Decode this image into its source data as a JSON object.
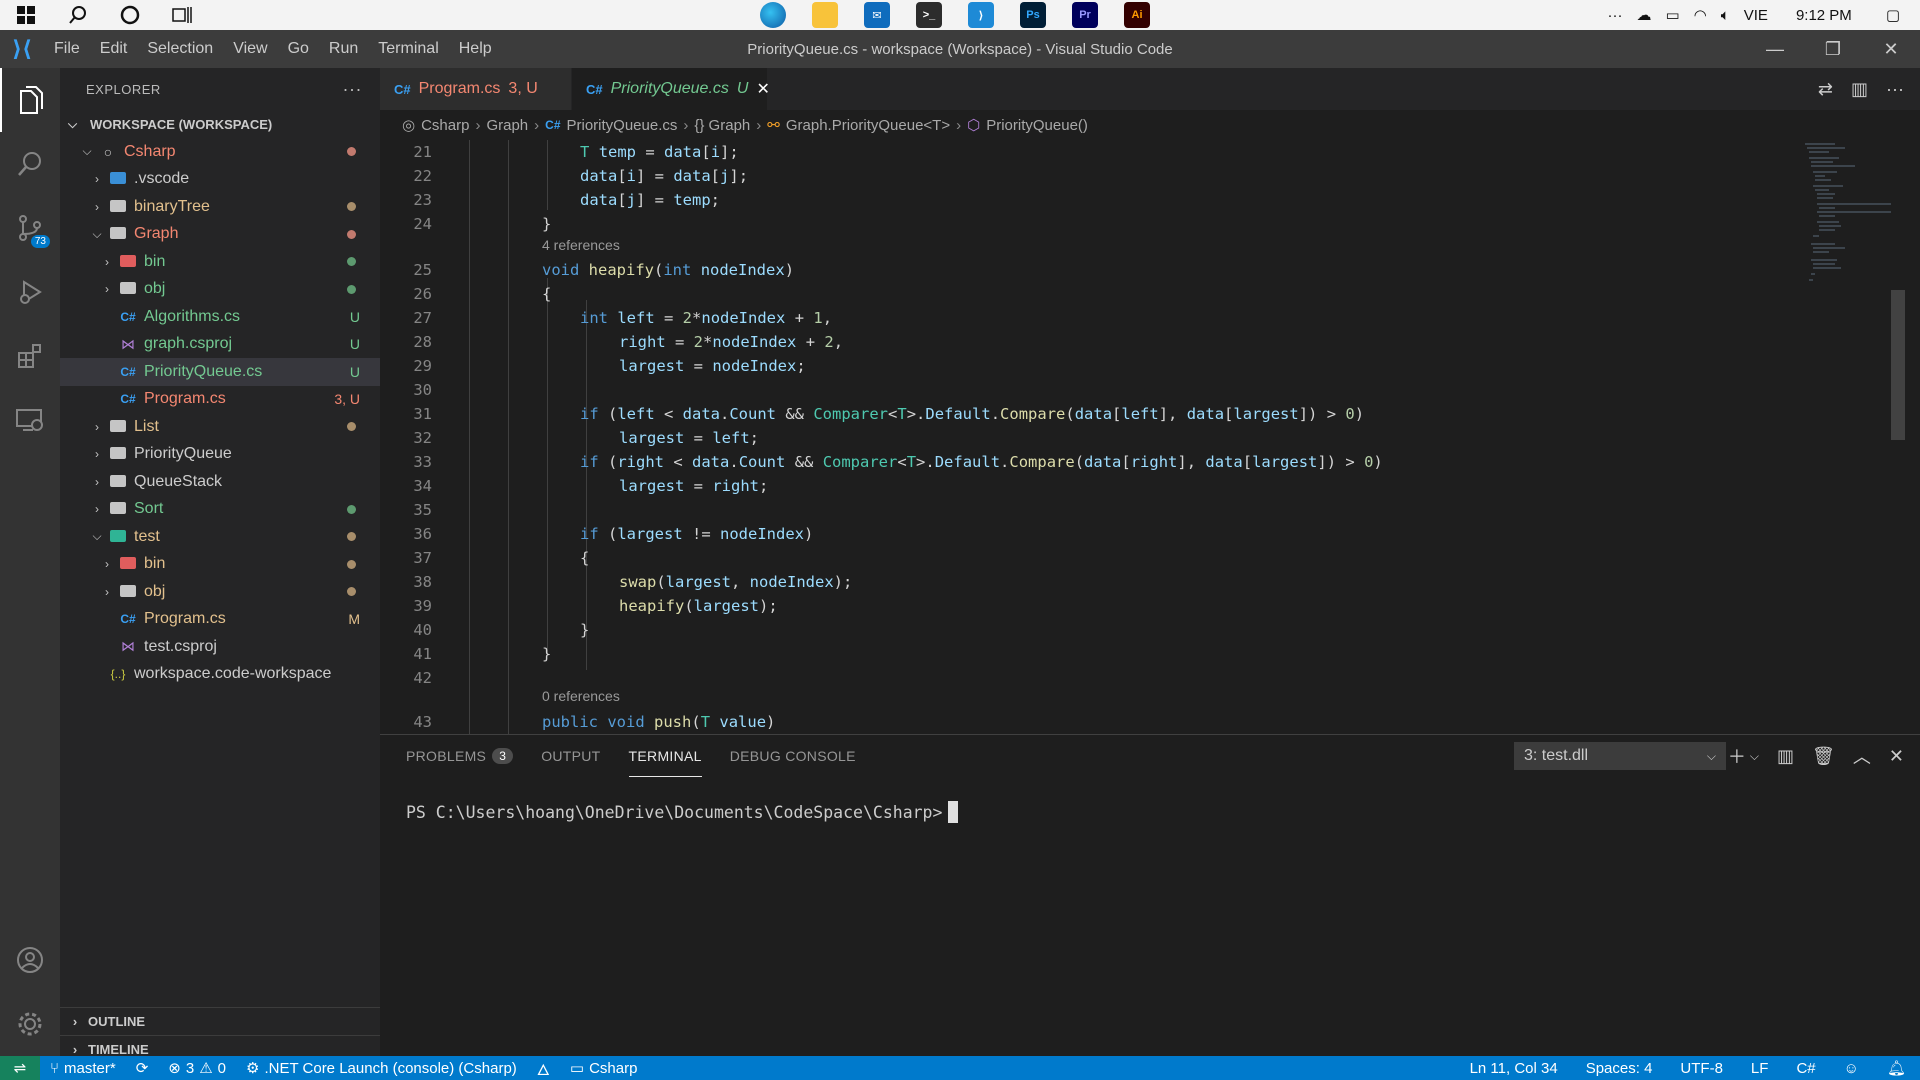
{
  "taskbar": {
    "apps": [
      "Edge",
      "File Explorer",
      "Mail",
      "Terminal",
      "VS Code",
      "Ps",
      "Pr",
      "Ai"
    ],
    "tray": {
      "more": "···",
      "language": "VIE",
      "time": "9:12 PM"
    }
  },
  "window": {
    "title": "PriorityQueue.cs - workspace (Workspace) - Visual Studio Code",
    "menu": [
      "File",
      "Edit",
      "Selection",
      "View",
      "Go",
      "Run",
      "Terminal",
      "Help"
    ]
  },
  "activity": {
    "scm_badge": "73"
  },
  "explorer": {
    "title": "EXPLORER",
    "workspace": "WORKSPACE (WORKSPACE)",
    "items": [
      {
        "label": "Csharp",
        "deco": ""
      },
      {
        "label": ".vscode",
        "deco": ""
      },
      {
        "label": "binaryTree",
        "deco": ""
      },
      {
        "label": "Graph",
        "deco": ""
      },
      {
        "label": "bin",
        "deco": ""
      },
      {
        "label": "obj",
        "deco": ""
      },
      {
        "label": "Algorithms.cs",
        "deco": "U"
      },
      {
        "label": "graph.csproj",
        "deco": "U"
      },
      {
        "label": "PriorityQueue.cs",
        "deco": "U"
      },
      {
        "label": "Program.cs",
        "deco": "3, U"
      },
      {
        "label": "List",
        "deco": ""
      },
      {
        "label": "PriorityQueue",
        "deco": ""
      },
      {
        "label": "QueueStack",
        "deco": ""
      },
      {
        "label": "Sort",
        "deco": ""
      },
      {
        "label": "test",
        "deco": ""
      },
      {
        "label": "bin",
        "deco": ""
      },
      {
        "label": "obj",
        "deco": ""
      },
      {
        "label": "Program.cs",
        "deco": "M"
      },
      {
        "label": "test.csproj",
        "deco": ""
      },
      {
        "label": "workspace.code-workspace",
        "deco": ""
      }
    ],
    "outline": "OUTLINE",
    "timeline": "TIMELINE"
  },
  "tabs": [
    {
      "icon": "C#",
      "label": "Program.cs",
      "status": "3, U"
    },
    {
      "icon": "C#",
      "label": "PriorityQueue.cs",
      "status": "U"
    }
  ],
  "breadcrumb": [
    "Csharp",
    "Graph",
    "PriorityQueue.cs",
    "{} Graph",
    "Graph.PriorityQueue<T>",
    "PriorityQueue()"
  ],
  "code": {
    "line_numbers": [
      "21",
      "22",
      "23",
      "24",
      "25",
      "26",
      "27",
      "28",
      "29",
      "30",
      "31",
      "32",
      "33",
      "34",
      "35",
      "36",
      "37",
      "38",
      "39",
      "40",
      "41",
      "42",
      "43"
    ],
    "refs": [
      "4 references",
      "0 references"
    ]
  },
  "panel": {
    "tabs": [
      "PROBLEMS",
      "OUTPUT",
      "TERMINAL",
      "DEBUG CONSOLE"
    ],
    "problems_count": "3",
    "terminal_select": "3: test.dll",
    "prompt": "PS C:\\Users\\hoang\\OneDrive\\Documents\\CodeSpace\\Csharp>"
  },
  "status": {
    "branch": "master*",
    "errors": "3",
    "warnings": "0",
    "launch": ".NET Core Launch (console) (Csharp)",
    "project": "Csharp",
    "position": "Ln 11, Col 34",
    "spaces": "Spaces: 4",
    "encoding": "UTF-8",
    "eol": "LF",
    "language": "C#"
  },
  "colors": {
    "accent": "#007acc",
    "untracked": "#73c991",
    "error": "#f48771",
    "modified": "#e2c08d"
  }
}
